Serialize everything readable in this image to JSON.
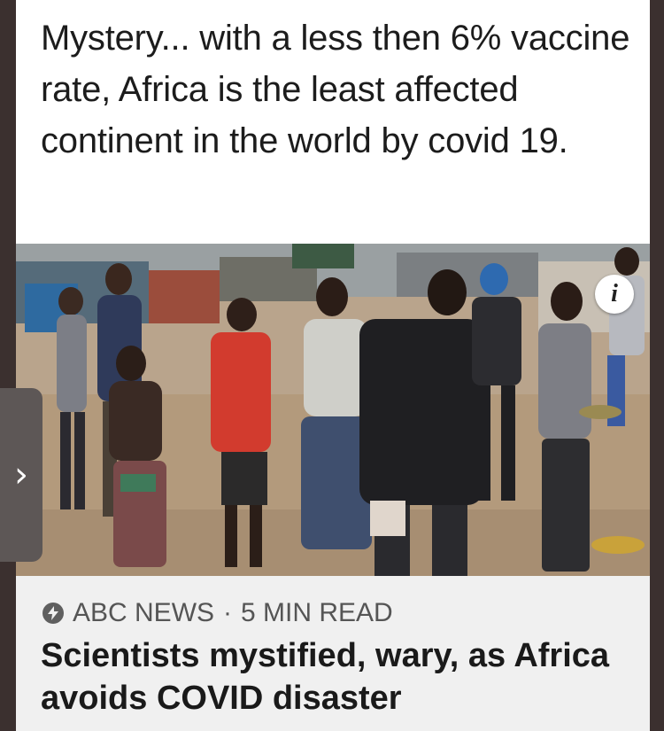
{
  "post": {
    "text": "Mystery... with a less then 6% vaccine rate, Africa is the least affected continent in the world by covid 19."
  },
  "image": {
    "info_button_glyph": "i",
    "description_icon": "info-icon"
  },
  "link_preview": {
    "source": "ABC NEWS",
    "separator": "·",
    "read_time": "5 MIN READ",
    "headline": "Scientists mystified, wary, as Africa avoids COVID disaster"
  },
  "navigation": {
    "next_glyph": "›"
  },
  "colors": {
    "card_bg": "#ffffff",
    "link_box_bg": "#f0f0f0",
    "frame": "#3b302f",
    "nav_tab": "#5d5756"
  }
}
